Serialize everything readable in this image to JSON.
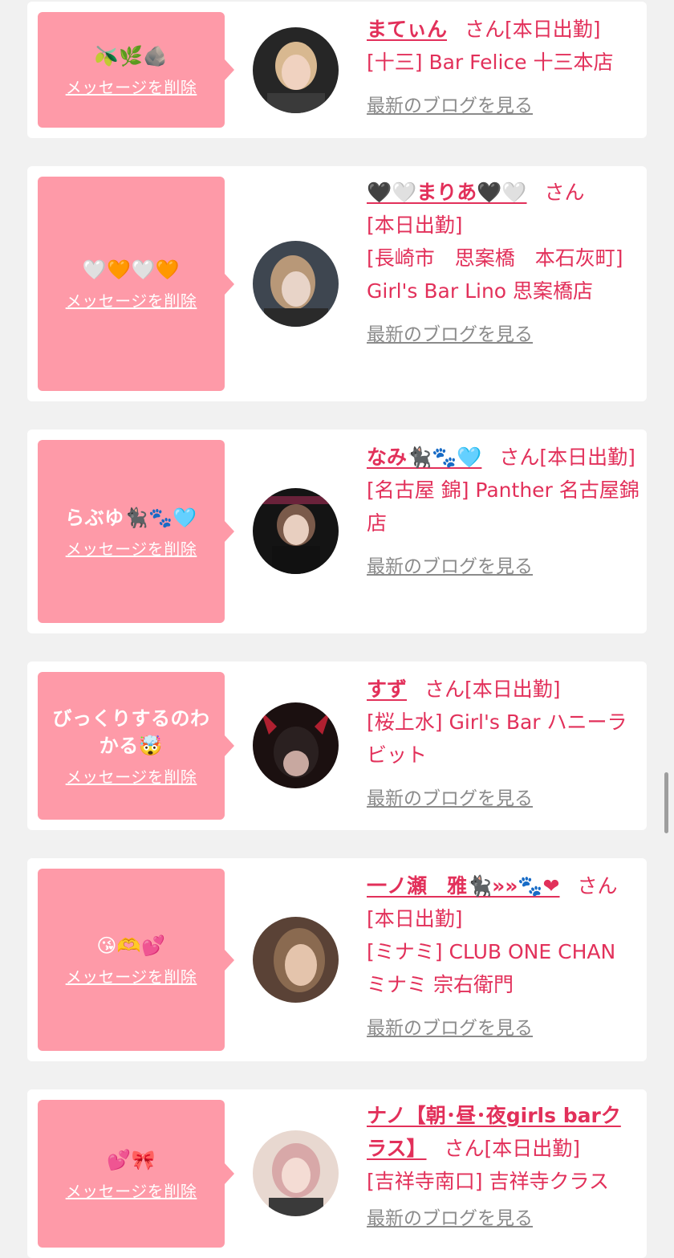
{
  "entries": [
    {
      "message": "🫒🌿🪨",
      "delete_label": "メッセージを削除",
      "name": "まてぃん",
      "suffix": "さん",
      "status": "[本日出勤]",
      "shop": "[十三] Bar Felice 十三本店",
      "blog": "最新のブログを見る",
      "avatar_colors": [
        "#2b2b2b",
        "#d9c0a0"
      ]
    },
    {
      "message": "🤍🧡🤍🧡",
      "delete_label": "メッセージを削除",
      "name": "🖤🤍まりあ🖤🤍",
      "suffix": "さん",
      "status": "[本日出勤]",
      "shop": "[長崎市　思案橋　本石灰町] Girl's Bar Lino 思案橋店",
      "blog": "最新のブログを見る",
      "avatar_colors": [
        "#3e4650",
        "#c8b8a8"
      ]
    },
    {
      "message": "らぶゆ🐈‍⬛🐾🩵",
      "delete_label": "メッセージを削除",
      "name": "なみ🐈‍⬛🐾🩵",
      "suffix": "さん",
      "status": "[本日出勤]",
      "shop": "[名古屋 錦] Panther 名古屋錦店",
      "blog": "最新のブログを見る",
      "avatar_colors": [
        "#1a1a1a",
        "#7a5a4a"
      ]
    },
    {
      "message": "びっくりするのわかる🤯",
      "delete_label": "メッセージを削除",
      "name": "すず",
      "suffix": "さん",
      "status": "[本日出勤]",
      "shop": "[桜上水] Girl's Bar ハニーラビット",
      "blog": "最新のブログを見る",
      "avatar_colors": [
        "#1b1010",
        "#b02030"
      ]
    },
    {
      "message": "😘🫶💕",
      "delete_label": "メッセージを削除",
      "name": "一ノ瀬　雅🐈‍⬛»»🐾❤",
      "suffix": "さん",
      "status": "[本日出勤]",
      "shop": "[ミナミ] CLUB ONE CHAN ミナミ 宗右衛門",
      "blog": "最新のブログを見る",
      "avatar_colors": [
        "#6a5040",
        "#d8b8a0"
      ]
    },
    {
      "message": "💕🎀",
      "delete_label": "メッセージを削除",
      "name": "ナノ【朝･昼･夜girls barクラス】",
      "suffix": "さん",
      "status": "[本日出勤]",
      "shop": "[吉祥寺南口] 吉祥寺クラス",
      "blog": "最新のブログを見る",
      "avatar_colors": [
        "#e8d0c8",
        "#c89090"
      ]
    }
  ]
}
